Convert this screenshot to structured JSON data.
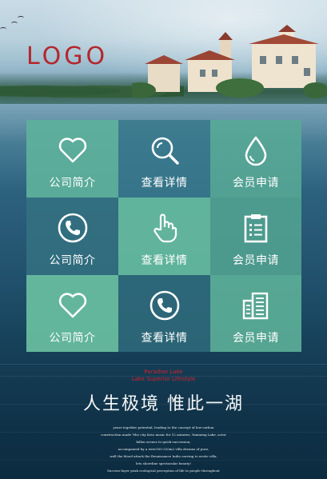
{
  "brand": {
    "logo_text": "LOGO",
    "logo_color": "#b5262c"
  },
  "menu": {
    "tiles": [
      {
        "label": "公司简介",
        "icon": "heart-icon"
      },
      {
        "label": "查看详情",
        "icon": "search-icon"
      },
      {
        "label": "会员申请",
        "icon": "water-drop-icon"
      },
      {
        "label": "公司简介",
        "icon": "phone-icon"
      },
      {
        "label": "查看详情",
        "icon": "hand-pointer-icon"
      },
      {
        "label": "会员申请",
        "icon": "clipboard-icon"
      },
      {
        "label": "公司简介",
        "icon": "heart-icon"
      },
      {
        "label": "查看详情",
        "icon": "phone-icon"
      },
      {
        "label": "会员申请",
        "icon": "building-icon"
      }
    ]
  },
  "footer": {
    "red_lines": [
      "Paradise Lake",
      "Lake Superior Lifestyle"
    ],
    "slogan": "人生极境  惟此一湖",
    "body_lines": [
      "years together potential, leading to the concept of low-carbon",
      "construction made ?the city Koto music for 12 minutes, Yamming Lake, actor",
      "fallen scenes to quick succession,",
      "accompanied by a river300-320m2 villa dreams of pure,",
      "well the blood attack the Renaissance Indio carving to erotic villa,",
      "lets shoreline spectacular beauty!",
      "Success-layer peak ecological perception of life to people throughout"
    ]
  }
}
